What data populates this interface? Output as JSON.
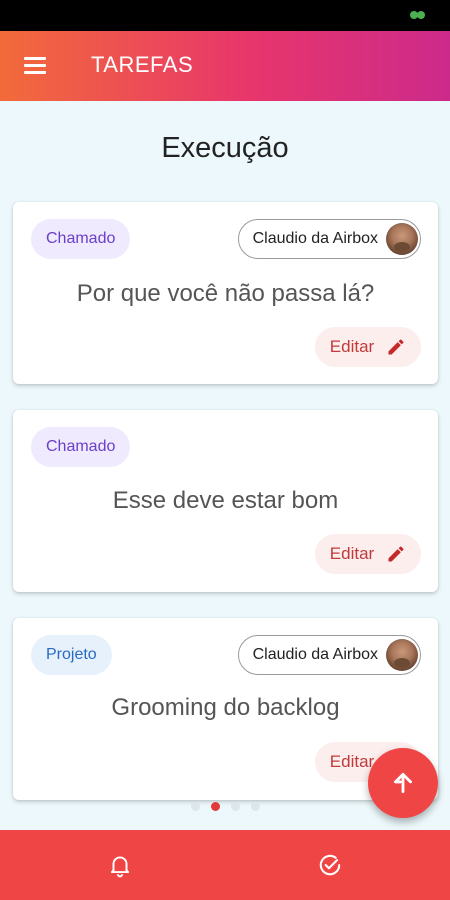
{
  "app": {
    "title": "TAREFAS",
    "colors": {
      "gradient_start": "#f26b3a",
      "gradient_end": "#cc2a8b",
      "accent": "#ef4545"
    }
  },
  "page": {
    "title": "Execução"
  },
  "cards": [
    {
      "type": "Chamado",
      "assignee": "Claudio da Airbox",
      "title": "Por que você não passa lá?",
      "edit_label": "Editar"
    },
    {
      "type": "Chamado",
      "title": "Esse deve estar bom",
      "edit_label": "Editar"
    },
    {
      "type": "Projeto",
      "assignee": "Claudio da Airbox",
      "title": "Grooming do backlog",
      "edit_label": "Editar"
    }
  ],
  "pager": {
    "total_pages": 4,
    "current_page": 2
  },
  "icons": {
    "menu": "menu-icon",
    "edit": "pencil-icon",
    "fab": "arrow-up-icon",
    "nav_left": "bell-icon",
    "nav_right": "check-circle-icon"
  }
}
